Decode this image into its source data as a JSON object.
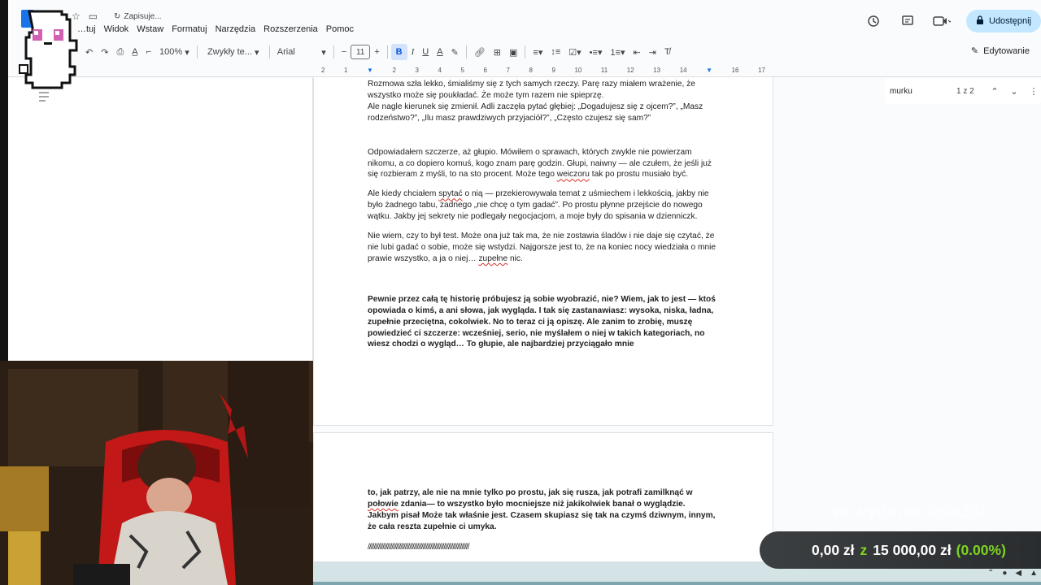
{
  "titlebar": {
    "save_status": "Zapisuje...",
    "menu": [
      "…tuj",
      "Widok",
      "Wstaw",
      "Formatuj",
      "Narzędzia",
      "Rozszerzenia",
      "Pomoc"
    ],
    "share_label": "Udostępnij"
  },
  "toolbar": {
    "zoom": "100%",
    "style": "Zwykły te...",
    "font": "Arial",
    "font_size": "11",
    "mode": "Edytowanie"
  },
  "ruler": [
    "2",
    "1",
    "1",
    "2",
    "3",
    "4",
    "5",
    "6",
    "7",
    "8",
    "9",
    "10",
    "11",
    "12",
    "13",
    "14",
    "15",
    "16",
    "17",
    "18"
  ],
  "find": {
    "query": "murku",
    "count": "1 z 2"
  },
  "document": {
    "page1": {
      "p1": "Rozmowa szła lekko, śmialiśmy się z tych samych rzeczy. Parę razy miałem wrażenie, że wszystko może się poukładać. Że może tym razem nie spieprzę.",
      "p1b": " Ale nagle kierunek się zmienił. Adli zaczęła pytać głębiej: „Dogadujesz się z ojcem?”, „Masz rodzeństwo?”, „Ilu masz prawdziwych przyjaciół?”, „Często czujesz się sam?”",
      "p2a": "Odpowiadałem szczerze, aż głupio. Mówiłem o sprawach, których zwykle nie powierzam nikomu, a co dopiero komuś, kogo znam parę godzin. Głupi, naiwny — ale czułem, że jeśli już się rozbieram z myśli, to na sto procent. Może tego ",
      "p2err": "weiczoru",
      "p2b": " tak po prostu musiało być.",
      "p3a": "Ale kiedy chciałem ",
      "p3err": "spytać",
      "p3b": " o nią — przekierowywała temat z uśmiechem i lekkością, jakby nie było żadnego tabu, żadnego „nie chcę o tym gadać”. Po prostu płynne przejście do nowego wątku. Jakby jej sekrety nie podlegały negocjacjom, a moje były do spisania w dzienniczk.",
      "p4a": "Nie wiem, czy to był test. Może ona już tak ma, że nie zostawia śladów i nie daje się czytać, że nie lubi gadać o sobie, może się wstydzi. Najgorsze jest to, że na koniec nocy wiedziała o mnie prawie wszystko, a ja o niej… ",
      "p4err": "zupełne",
      "p4b": " nic.",
      "p5": "Pewnie przez całą tę historię próbujesz ją sobie wyobrazić, nie? Wiem, jak to jest — ktoś opowiada o kimś, a ani słowa, jak wygląda. I tak się zastanawiasz: wysoka, niska, ładna, zupełnie przeciętna, cokolwiek. No to teraz ci ją opiszę. Ale zanim to zrobię, muszę powiedzieć ci szczerze: wcześniej, serio, nie myślałem o niej w takich kategoriach, no wiesz chodzi o wygląd… To głupie, ale najbardziej przyciągało mnie"
    },
    "page2": {
      "l1": "to, jak patrzy, ale nie na mnie tylko po prostu, jak się rusza, jak potrafi zamilknąć w",
      "l2err": "połowie",
      "l2b": " zdania— to wszystko było mocniejsze niż jakikolwiek banał o wyglądzie.",
      "l3": "Jakbym pisał Może tak właśnie jest. Czasem skupiasz się tak na czymś dziwnym, innym, że cała reszta zupełnie ci umyka.",
      "l4": "////////////////////////////////////////////////////////////////////"
    }
  },
  "overlay": {
    "label": "na wydanie książki",
    "current": "0,00 zł",
    "sep": "z",
    "goal": "15 000,00 zł",
    "percent": "(0.00%)"
  },
  "colors": {
    "accent": "#1a73e8",
    "share_bg": "#c2e7ff",
    "progress_green": "#7ed321"
  }
}
